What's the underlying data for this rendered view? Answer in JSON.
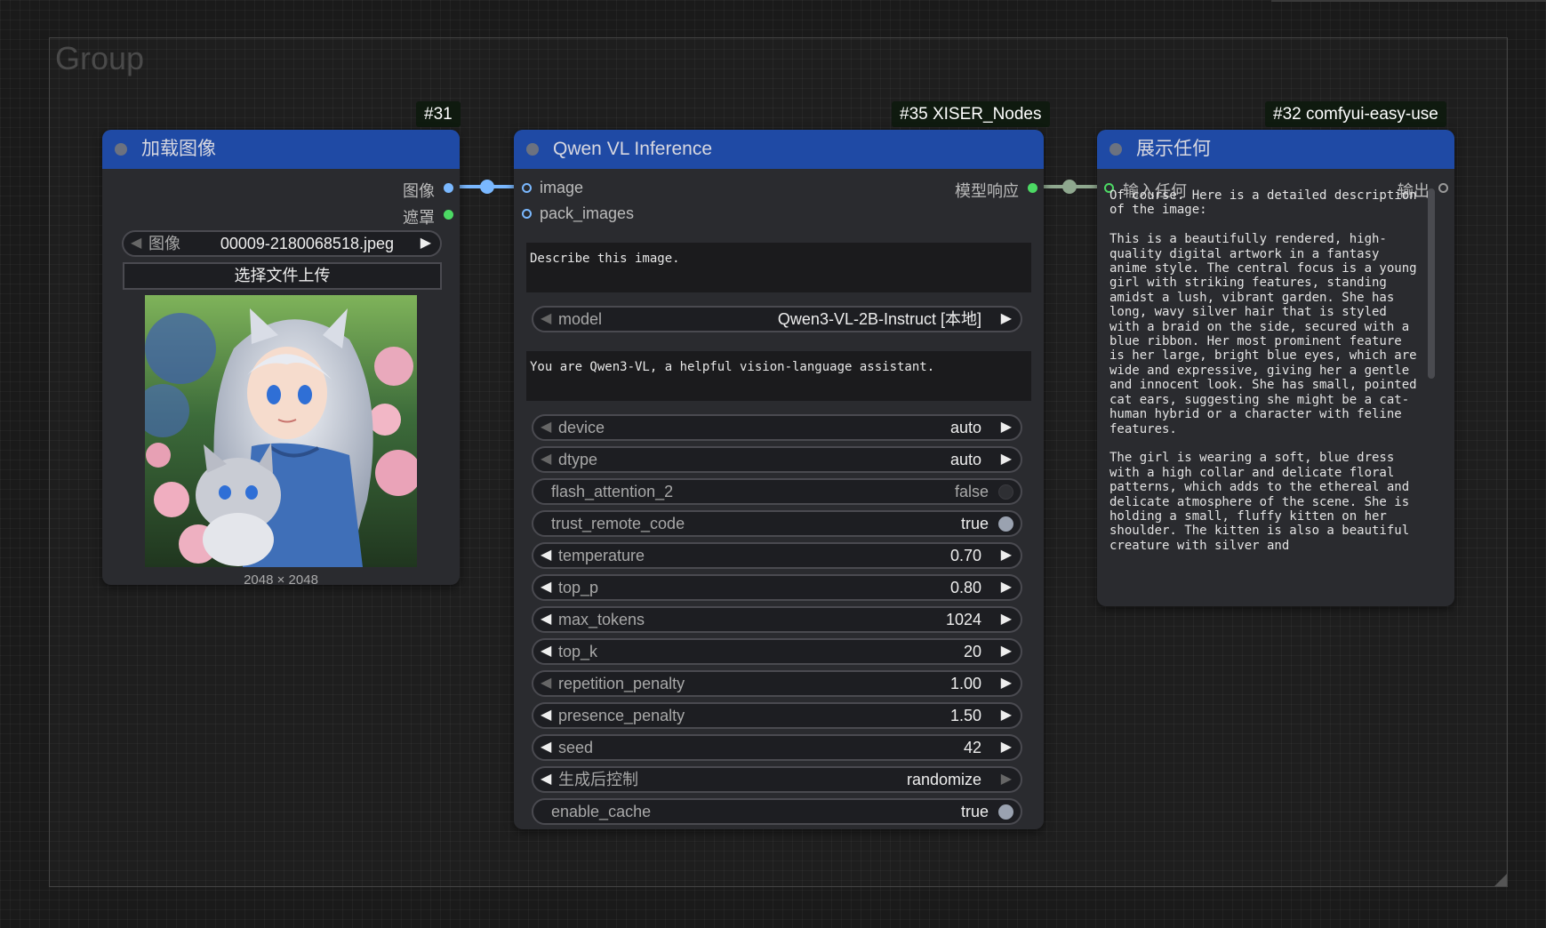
{
  "group": {
    "title": "Group"
  },
  "node_load_image": {
    "id_badge": "#31",
    "title": "加载图像",
    "outputs": [
      "图像",
      "遮罩"
    ],
    "image_widget": {
      "label": "图像",
      "value": "00009-2180068518.jpeg"
    },
    "upload_label": "选择文件上传",
    "image_dims": "2048 × 2048"
  },
  "node_qwen": {
    "id_badge": "#35 XISER_Nodes",
    "title": "Qwen VL Inference",
    "inputs": [
      "image",
      "pack_images"
    ],
    "output": "模型响应",
    "prompt_text": "Describe this image.",
    "system_text": "You are Qwen3-VL, a helpful vision-language assistant.",
    "model": {
      "label": "model",
      "value": "Qwen3-VL-2B-Instruct [本地]"
    },
    "widgets": [
      {
        "label": "device",
        "value": "auto"
      },
      {
        "label": "dtype",
        "value": "auto"
      },
      {
        "label": "flash_attention_2",
        "value": "false"
      },
      {
        "label": "trust_remote_code",
        "value": "true"
      },
      {
        "label": "temperature",
        "value": "0.70"
      },
      {
        "label": "top_p",
        "value": "0.80"
      },
      {
        "label": "max_tokens",
        "value": "1024"
      },
      {
        "label": "top_k",
        "value": "20"
      },
      {
        "label": "repetition_penalty",
        "value": "1.00"
      },
      {
        "label": "presence_penalty",
        "value": "1.50"
      },
      {
        "label": "seed",
        "value": "42"
      },
      {
        "label": "生成后控制",
        "value": "randomize"
      },
      {
        "label": "enable_cache",
        "value": "true"
      }
    ]
  },
  "node_show_any": {
    "id_badge": "#32 comfyui-easy-use",
    "title": "展示任何",
    "input": "输入任何",
    "output": "输出",
    "text": "Of course. Here is a detailed description of the image:\n\nThis is a beautifully rendered, high-quality digital artwork in a fantasy anime style. The central focus is a young girl with striking features, standing amidst a lush, vibrant garden. She has long, wavy silver hair that is styled with a braid on the side, secured with a blue ribbon. Her most prominent feature is her large, bright blue eyes, which are wide and expressive, giving her a gentle and innocent look. She has small, pointed cat ears, suggesting she might be a cat-human hybrid or a character with feline features.\n\nThe girl is wearing a soft, blue dress with a high collar and delicate floral patterns, which adds to the ethereal and delicate atmosphere of the scene. She is holding a small, fluffy kitten on her shoulder. The kitten is also a beautiful creature with silver and"
  },
  "colors": {
    "header": "#1f4aa5",
    "node_bg": "#2a2b2f",
    "image_wire": "#7ab8ff",
    "text_wire": "#8fa88f"
  }
}
